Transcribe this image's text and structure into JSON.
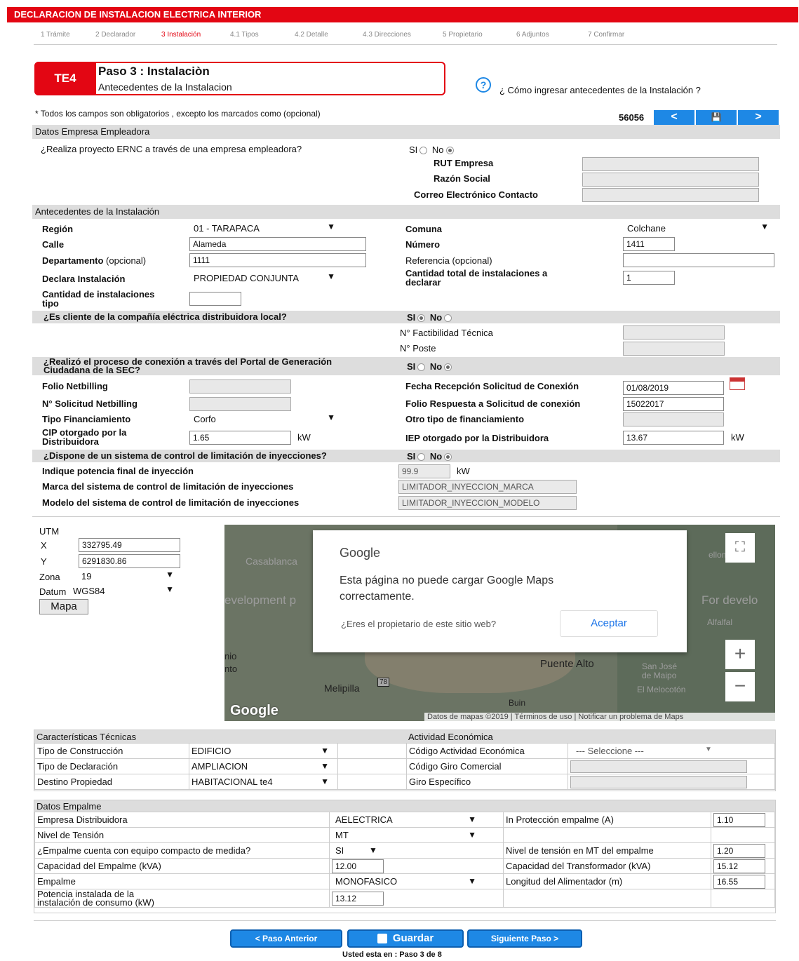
{
  "header": {
    "title": "DECLARACION DE INSTALACION ELECTRICA INTERIOR"
  },
  "steps": [
    {
      "label": "1 Trámite",
      "active": false
    },
    {
      "label": "2 Declarador",
      "active": false
    },
    {
      "label": "3 Instalación",
      "active": true
    },
    {
      "label": "4.1 Tipos",
      "active": false
    },
    {
      "label": "4.2 Detalle",
      "active": false
    },
    {
      "label": "4.3 Direcciones",
      "active": false
    },
    {
      "label": "5 Propietario",
      "active": false
    },
    {
      "label": "6 Adjuntos",
      "active": false
    },
    {
      "label": "7 Confirmar",
      "active": false
    }
  ],
  "page": {
    "badge": "TE4",
    "title": "Paso 3 : Instalaciòn",
    "subtitle": "Antecedentes de la Instalacion",
    "help_text": "¿ Cómo ingresar antecedentes de la Instalación ?",
    "required_note": "* Todos los campos son obligatorios , excepto los marcados como (opcional)",
    "record_number": "56056",
    "nav": {
      "prev": "<",
      "save": "💾",
      "next": ">"
    }
  },
  "empresa": {
    "section": "Datos Empresa Empleadora",
    "question": "¿Realiza proyecto ERNC a través de una empresa empleadora?",
    "si": "SI",
    "no": "No",
    "selected": "No",
    "rut_label": "RUT Empresa",
    "razon_label": "Razón Social",
    "correo_label": "Correo Electrónico Contacto"
  },
  "instalacion": {
    "section": "Antecedentes de la Instalación",
    "region_label": "Región",
    "region_value": "01 - TARAPACA",
    "comuna_label": "Comuna",
    "comuna_value": "Colchane",
    "calle_label": "Calle",
    "calle_value": "Alameda",
    "numero_label": "Número",
    "numero_value": "1411",
    "depto_label": "Departamento",
    "depto_opt": "(opcional)",
    "depto_value": "1111",
    "ref_label": "Referencia (opcional)",
    "ref_value": "",
    "declara_label": "Declara Instalación",
    "declara_value": "PROPIEDAD CONJUNTA",
    "cant_total_label_1": "Cantidad total de instalaciones a",
    "cant_total_label_2": "declarar",
    "cant_total_value": "1",
    "cant_tipo_label_1": "Cantidad de instalaciones",
    "cant_tipo_label_2": "tipo",
    "cant_tipo_value": ""
  },
  "cliente": {
    "question": "¿Es cliente de la compañía eléctrica distribuidora local?",
    "si": "SI",
    "no": "No",
    "selected": "SI",
    "factibilidad_label": "N° Factibilidad Técnica",
    "poste_label": "N° Poste"
  },
  "portal": {
    "question_1": "¿Realizó el proceso de conexión a través del Portal de Generación",
    "question_2": "Ciudadana de la SEC?",
    "si": "SI",
    "no": "No",
    "selected": "No",
    "folio_label": "Folio Netbilling",
    "fecha_label": "Fecha Recepción Solicitud de Conexión",
    "fecha_value": "01/08/2019",
    "solicitud_label": "N° Solicitud Netbilling",
    "folio_resp_label": "Folio Respuesta a Solicitud de conexión",
    "folio_resp_value": "15022017",
    "financ_label": "Tipo Financiamiento",
    "financ_value": "Corfo",
    "otro_financ_label": "Otro tipo de financiamiento",
    "cip_label_1": "CIP otorgado por la",
    "cip_label_2": "Distribuidora",
    "cip_value": "1.65",
    "cip_unit": "kW",
    "iep_label": "IEP otorgado por la Distribuidora",
    "iep_value": "13.67",
    "iep_unit": "kW"
  },
  "limitacion": {
    "question": "¿Dispone de un sistema de control de limitación de inyecciones?",
    "si": "SI",
    "no": "No",
    "selected": "No",
    "potencia_label": "Indique potencia final de inyección",
    "potencia_value": "99.9",
    "potencia_unit": "kW",
    "marca_label": "Marca del sistema de control de limitación de inyecciones",
    "marca_value": "LIMITADOR_INYECCION_MARCA",
    "modelo_label": "Modelo del sistema de control de limitación de inyecciones",
    "modelo_value": "LIMITADOR_INYECCION_MODELO"
  },
  "utm": {
    "title": "UTM",
    "x_label": "X",
    "x_value": "332795.49",
    "y_label": "Y",
    "y_value": "6291830.86",
    "zona_label": "Zona",
    "zona_value": "19",
    "datum_label": "Datum",
    "datum_value": "WGS84",
    "mapa_button": "Mapa"
  },
  "map": {
    "dialog_brand": "Google",
    "dialog_message_1": "Esta página no puede cargar Google Maps",
    "dialog_message_2": "correctamente.",
    "dialog_question": "¿Eres el propietario de este sitio web?",
    "dialog_button": "Aceptar",
    "labels": [
      "Casablanca",
      "evelopment p",
      "For develo",
      "Puente Alto",
      "Melipilla",
      "San José",
      "de Maipo",
      "El Melocotón",
      "Alfalfal",
      "Buin",
      "ellones",
      "nio",
      "nto",
      "78"
    ],
    "footer": "Datos de mapas ©2019  |  Términos de uso  |  Notificar un problema de Maps",
    "logo": "Google"
  },
  "tecnicas": {
    "section_left": "Características Técnicas",
    "section_right": "Actividad Económica",
    "rows": [
      {
        "label": "Tipo de Construcción",
        "value": "EDIFICIO",
        "r_label": "Código Actividad Económica",
        "r_value": "--- Seleccione ---"
      },
      {
        "label": "Tipo de Declaración",
        "value": "AMPLIACION",
        "r_label": "Código Giro Comercial",
        "r_value": ""
      },
      {
        "label": "Destino Propiedad",
        "value": "HABITACIONAL te4",
        "r_label": "Giro Específico",
        "r_value": ""
      }
    ]
  },
  "empalme": {
    "section": "Datos Empalme",
    "rows": [
      {
        "label": "Empresa Distribuidora",
        "value": "AELECTRICA",
        "r_label": "In Protección empalme (A)",
        "r_value": "1.10"
      },
      {
        "label": "Nivel de Tensión",
        "value": "MT",
        "r_label": "",
        "r_value": ""
      },
      {
        "label": "¿Empalme cuenta con equipo compacto de medida?",
        "value": "SI",
        "r_label": "Nivel de tensión en MT del empalme",
        "r_value": "1.20"
      },
      {
        "label": "Capacidad del Empalme (kVA)",
        "value": "12.00",
        "r_label": "Capacidad del Transformador (kVA)",
        "r_value": "15.12"
      },
      {
        "label": "Empalme",
        "value": "MONOFASICO",
        "r_label": "Longitud del Alimentador (m)",
        "r_value": "16.55"
      },
      {
        "label": "Potencia instalada de la",
        "label2": "instalación de consumo (kW)",
        "value": "13.12",
        "r_label": "",
        "r_value": ""
      }
    ]
  },
  "footer": {
    "prev": "< Paso Anterior",
    "save": "Guardar",
    "next": "Siguiente Paso >",
    "position": "Usted esta en : Paso 3 de 8"
  }
}
